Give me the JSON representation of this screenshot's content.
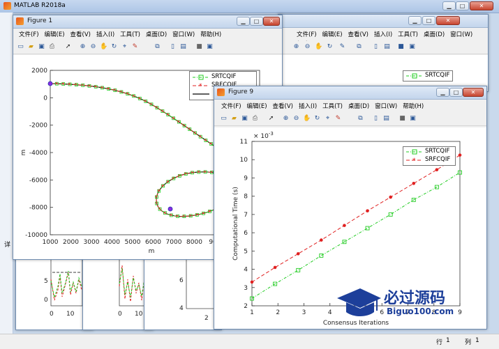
{
  "main_window": {
    "title": "MATLAB R2018a",
    "status_row_label": "行",
    "status_row_value": "1",
    "status_col_label": "列",
    "status_col_value": "1"
  },
  "back_window": {
    "menu": [
      "文件(F)",
      "编辑(E)",
      "查看(V)",
      "插入(I)",
      "工具(T)",
      "桌面(D)",
      "窗口(W)",
      "帮助(H)"
    ],
    "legend_label": "SRTCQIF"
  },
  "figure1": {
    "title": "Figure 1",
    "menu": [
      "文件(F)",
      "编辑(E)",
      "查看(V)",
      "插入(I)",
      "工具(T)",
      "桌面(D)",
      "窗口(W)",
      "帮助(H)"
    ],
    "legend": [
      "SRTCQIF",
      "SRFCQIF",
      ""
    ],
    "xlabel": "m",
    "ylabel": "m",
    "xticks": [
      "1000",
      "2000",
      "3000",
      "4000",
      "5000",
      "6000",
      "7000",
      "8000",
      "900"
    ],
    "yticks": [
      "2000",
      "0",
      "-2000",
      "-4000",
      "-6000",
      "-8000",
      "-10000"
    ]
  },
  "figure9": {
    "title": "Figure 9",
    "menu": [
      "文件(F)",
      "编辑(E)",
      "查看(V)",
      "插入(I)",
      "工具(T)",
      "桌面(D)",
      "窗口(W)",
      "帮助(H)"
    ],
    "legend": [
      "SRTCQIF",
      "SRFCQIF"
    ],
    "exponent": "× 10",
    "exponent_power": "-3",
    "xticks": [
      "1",
      "2",
      "3",
      "4",
      "5",
      "6",
      "7",
      "8",
      "9"
    ],
    "yticks": [
      "11",
      "10",
      "9",
      "8",
      "7",
      "6",
      "5",
      "4",
      "3",
      "2"
    ]
  },
  "bottom_figs": {
    "ticks_a": [
      "5",
      "0",
      "0",
      "10"
    ],
    "ticks_b": [
      "0",
      "10"
    ],
    "ticks_c": [
      "6",
      "4",
      "2"
    ],
    "side_label": "详"
  },
  "watermark": {
    "cn": "必过源码",
    "en": "Biguo100.com"
  },
  "colors": {
    "srtcqif": "#22cc22",
    "srfcqif": "#e02020",
    "truth": "#000000",
    "desktop": "#c9d9ec"
  },
  "chart_data": {
    "type": "line",
    "xlabel": "Consensus Iterations",
    "ylabel": "Computational Time (s)",
    "x": [
      1,
      2,
      3,
      4,
      5,
      6,
      7,
      8,
      9
    ],
    "xlim": [
      1,
      9
    ],
    "ylim": [
      2,
      11
    ],
    "y_scale_note": "× 10^-3",
    "series": [
      {
        "name": "SRTCQIF",
        "values": [
          2.4,
          3.2,
          3.95,
          4.75,
          5.5,
          6.25,
          7.0,
          7.8,
          8.5,
          9.3
        ]
      },
      {
        "name": "SRFCQIF",
        "values": [
          3.3,
          4.1,
          4.85,
          5.6,
          6.4,
          7.2,
          7.95,
          8.7,
          9.45,
          10.25
        ]
      }
    ]
  }
}
